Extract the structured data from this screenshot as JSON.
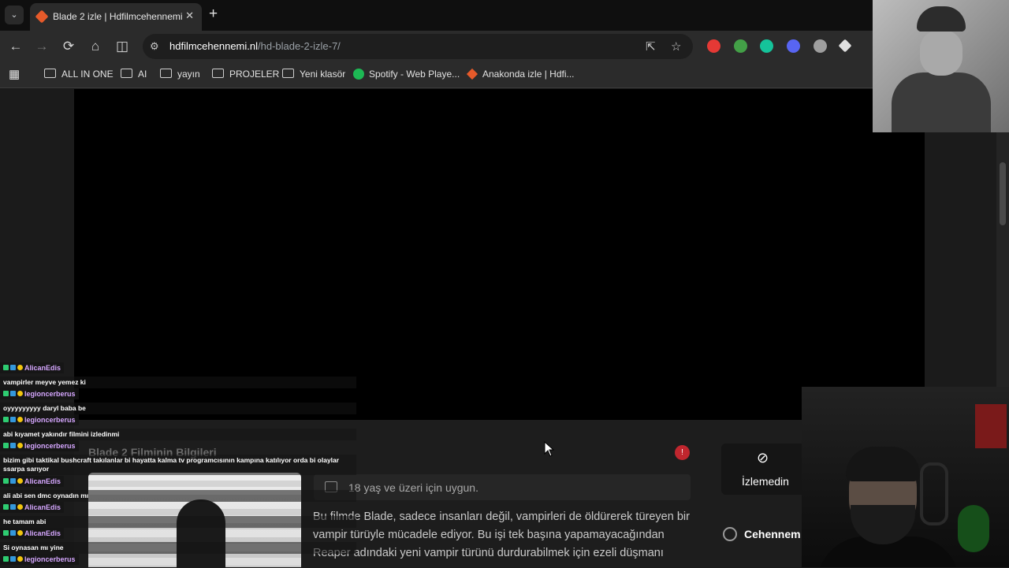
{
  "browser": {
    "tab": {
      "title": "Blade 2 izle | Hdfilmcehennemi",
      "close": "✕"
    },
    "new_tab": "+",
    "tab_search": "⌄",
    "url_host": "hdfilmcehennemi.nl",
    "url_path": "/hd-blade-2-izle-7/",
    "nav": {
      "back": "←",
      "forward": "→",
      "reload": "⟳",
      "home": "⌂",
      "split": "◫"
    },
    "omni_icons": {
      "info": "⚙",
      "cast": "⇱",
      "star": "☆"
    },
    "extensions": [
      {
        "icon": "red-circle-icon",
        "color": "#e53935"
      },
      {
        "icon": "shield-check-icon",
        "color": "#43a047"
      },
      {
        "icon": "grammarly-icon",
        "color": "#15c39a"
      },
      {
        "icon": "discord-icon",
        "color": "#5865f2"
      },
      {
        "icon": "shield-icon",
        "color": "#9e9e9e"
      },
      {
        "icon": "diamond-icon",
        "color": "#e0e0e0"
      }
    ],
    "apps_icon": "▦",
    "bookmarks": [
      {
        "label": "ALL IN ONE",
        "icon": "folder-icon"
      },
      {
        "label": "AI",
        "icon": "folder-icon"
      },
      {
        "label": "yayın",
        "icon": "folder-icon"
      },
      {
        "label": "PROJELER",
        "icon": "folder-icon"
      },
      {
        "label": "Yeni klasör",
        "icon": "folder-icon"
      },
      {
        "label": "Spotify - Web Playe...",
        "icon": "spotify-icon"
      },
      {
        "label": "Anakonda izle | Hdfi...",
        "icon": "site-flame-icon"
      }
    ]
  },
  "page": {
    "section_title": "Blade 2 Filminin Bilgileri",
    "age_rating": "18 yaş ve üzeri için uygun.",
    "description": "Bu filmde Blade, sadece insanları değil, vampirleri de öldürerek türeyen bir vampir türüyle mücadele ediyor. Bu işi tek başına yapamayacağından Reaper adındaki yeni vampir türünü durdurabilmek için ezeli düşmanı",
    "watch_label": "İzlemedin",
    "cehennem_label": "Cehennem",
    "notification": "!",
    "eye_icon": "⊘"
  },
  "chat": [
    {
      "user": "AlicanEdis",
      "message": "vampirler meyve yemez ki"
    },
    {
      "user": "legioncerberus",
      "message": "oyyyyyyyyy daryl baba be"
    },
    {
      "user": "legioncerberus",
      "message": "abi kıyamet yakındır filmini izledinmi"
    },
    {
      "user": "legioncerberus",
      "message": "bizim gibi taktikal bushcraft takılanlar bi hayatta kalma tv programcısının kampına katılıyor orda bi olaylar ssarpa sarıyor"
    },
    {
      "user": "AlicanEdis",
      "message": "ali abi sen dmc oynadın mı"
    },
    {
      "user": "AlicanEdis",
      "message": "he tamam abi"
    },
    {
      "user": "AlicanEdis",
      "message": "Si oynasan mı yine"
    },
    {
      "user": "legioncerberus",
      "message": ""
    }
  ]
}
